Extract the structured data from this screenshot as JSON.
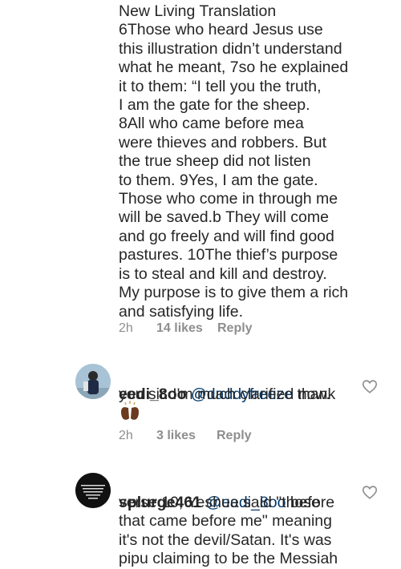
{
  "comment1": {
    "text": "New Living Translation\n6Those who heard Jesus use\nthis illustration didn’t understand\nwhat he meant, 7so he explained\nit to them: “I tell you the truth,\nI am the gate for the sheep.\n8All who came before mea\nwere thieves and robbers. But\nthe true sheep did not listen\nto them. 9Yes, I am the gate.\nThose who come in through me\nwill be saved.b They will come\nand go freely and will find good\npastures. 10The thief’s purpose\nis to steal and kill and destroy.\nMy purpose is to give them a rich\nand satisfying life.",
    "time": "2h",
    "likes": "14 likes",
    "reply": "Reply"
  },
  "comment2": {
    "username": "eedi_8oo",
    "mention": "@daddyfreeze",
    "text_line1_rest": " thank",
    "text_line2": "you sir. I'm much clarified now.",
    "emoji": "👏🏾",
    "time": "2h",
    "likes": "3 likes",
    "reply": "Reply"
  },
  "comment3": {
    "username": "splurge461",
    "mention": "@eedi_8oo",
    "text_line1_rest": " before",
    "text_rest": "verse 10, Yeshua said \"those\nthat came before me\" meaning\nit's not the devil/Satan. It's was\npipu claiming to be the Messiah"
  },
  "colors": {
    "text": "#262626",
    "meta": "#8e8e8e",
    "mention": "#00376b",
    "heart_outline": "#8e8e8e"
  },
  "icons": {
    "like": "heart-outline-icon",
    "avatar2": "user-photo",
    "avatar3": "text-logo-avatar"
  }
}
